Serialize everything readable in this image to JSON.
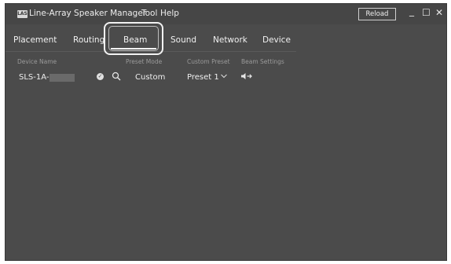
{
  "app": {
    "logo_text": "LAS",
    "title": "Line-Array Speaker Manager",
    "menu": [
      "Tool",
      "Help"
    ],
    "reload_label": "Reload",
    "window_controls": {
      "minimize": "_",
      "maximize": "☐",
      "close": "✕"
    }
  },
  "tabs": [
    "Placement",
    "Routing",
    "Beam",
    "Sound",
    "Network",
    "Device"
  ],
  "active_tab": "Beam",
  "columns": {
    "device_name": "Device Name",
    "preset_mode": "Preset Mode",
    "custom_preset": "Custom Preset",
    "beam_settings": "Beam Settings"
  },
  "rows": [
    {
      "device_name": "SLS-1A-",
      "status_icon": "check-circle-icon",
      "search_icon": "search-icon",
      "preset_mode": "Custom",
      "custom_preset": "Preset 1",
      "beam_icon": "speaker-beam-icon"
    }
  ],
  "colors": {
    "window_bg": "#4b4b4b",
    "text": "#efefef",
    "header_text": "#9a9a9a",
    "highlight": "#f2f2f2"
  }
}
